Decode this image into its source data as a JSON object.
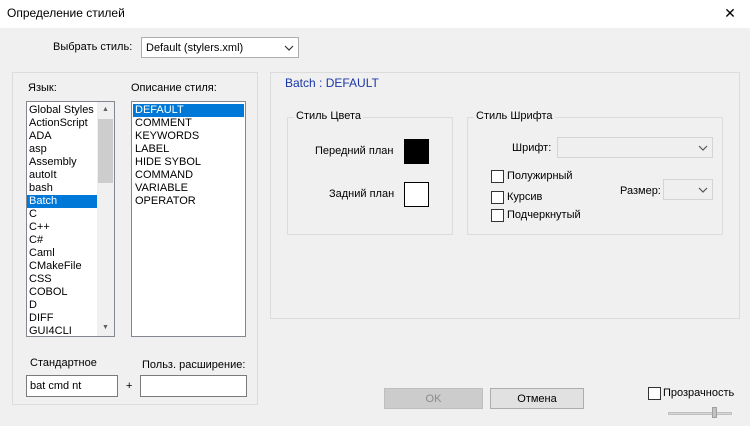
{
  "window": {
    "title": "Определение стилей",
    "close_glyph": "✕"
  },
  "style_picker": {
    "label": "Выбрать стиль:",
    "value": "Default (stylers.xml)"
  },
  "language_panel": {
    "label": "Язык:",
    "items": [
      "Global Styles",
      "ActionScript",
      "ADA",
      "asp",
      "Assembly",
      "autoIt",
      "bash",
      "Batch",
      "C",
      "C++",
      "C#",
      "Caml",
      "CMakeFile",
      "CSS",
      "COBOL",
      "D",
      "DIFF",
      "GUI4CLI"
    ],
    "selected_index": 7,
    "scroll_up_glyph": "▲",
    "scroll_down_glyph": "▼"
  },
  "style_panel": {
    "label": "Описание стиля:",
    "items": [
      "DEFAULT",
      "COMMENT",
      "KEYWORDS",
      "LABEL",
      "HIDE SYBOL",
      "COMMAND",
      "VARIABLE",
      "OPERATOR"
    ],
    "selected_index": 0
  },
  "extensions": {
    "default_label": "Стандартное",
    "default_value": "bat cmd nt",
    "plus": "+",
    "user_label": "Польз. расширение:",
    "user_value": ""
  },
  "details": {
    "header": "Batch : DEFAULT",
    "color_group": {
      "label": "Стиль Цвета",
      "foreground_label": "Передний план",
      "background_label": "Задний план",
      "foreground_color": "#000000",
      "background_color": "#ffffff"
    },
    "font_group": {
      "label": "Стиль Шрифта",
      "font_label": "Шрифт:",
      "font_value": "",
      "bold_label": "Полужирный",
      "italic_label": "Курсив",
      "underline_label": "Подчеркнутый",
      "size_label": "Размер:",
      "size_value": ""
    }
  },
  "buttons": {
    "ok": "OK",
    "cancel": "Отмена"
  },
  "transparency": {
    "label": "Прозрачность"
  },
  "icons": {
    "dropdown": "chevron-down-icon"
  },
  "colors": {
    "selection": "#0078d7",
    "header_text": "#1a36a8"
  }
}
